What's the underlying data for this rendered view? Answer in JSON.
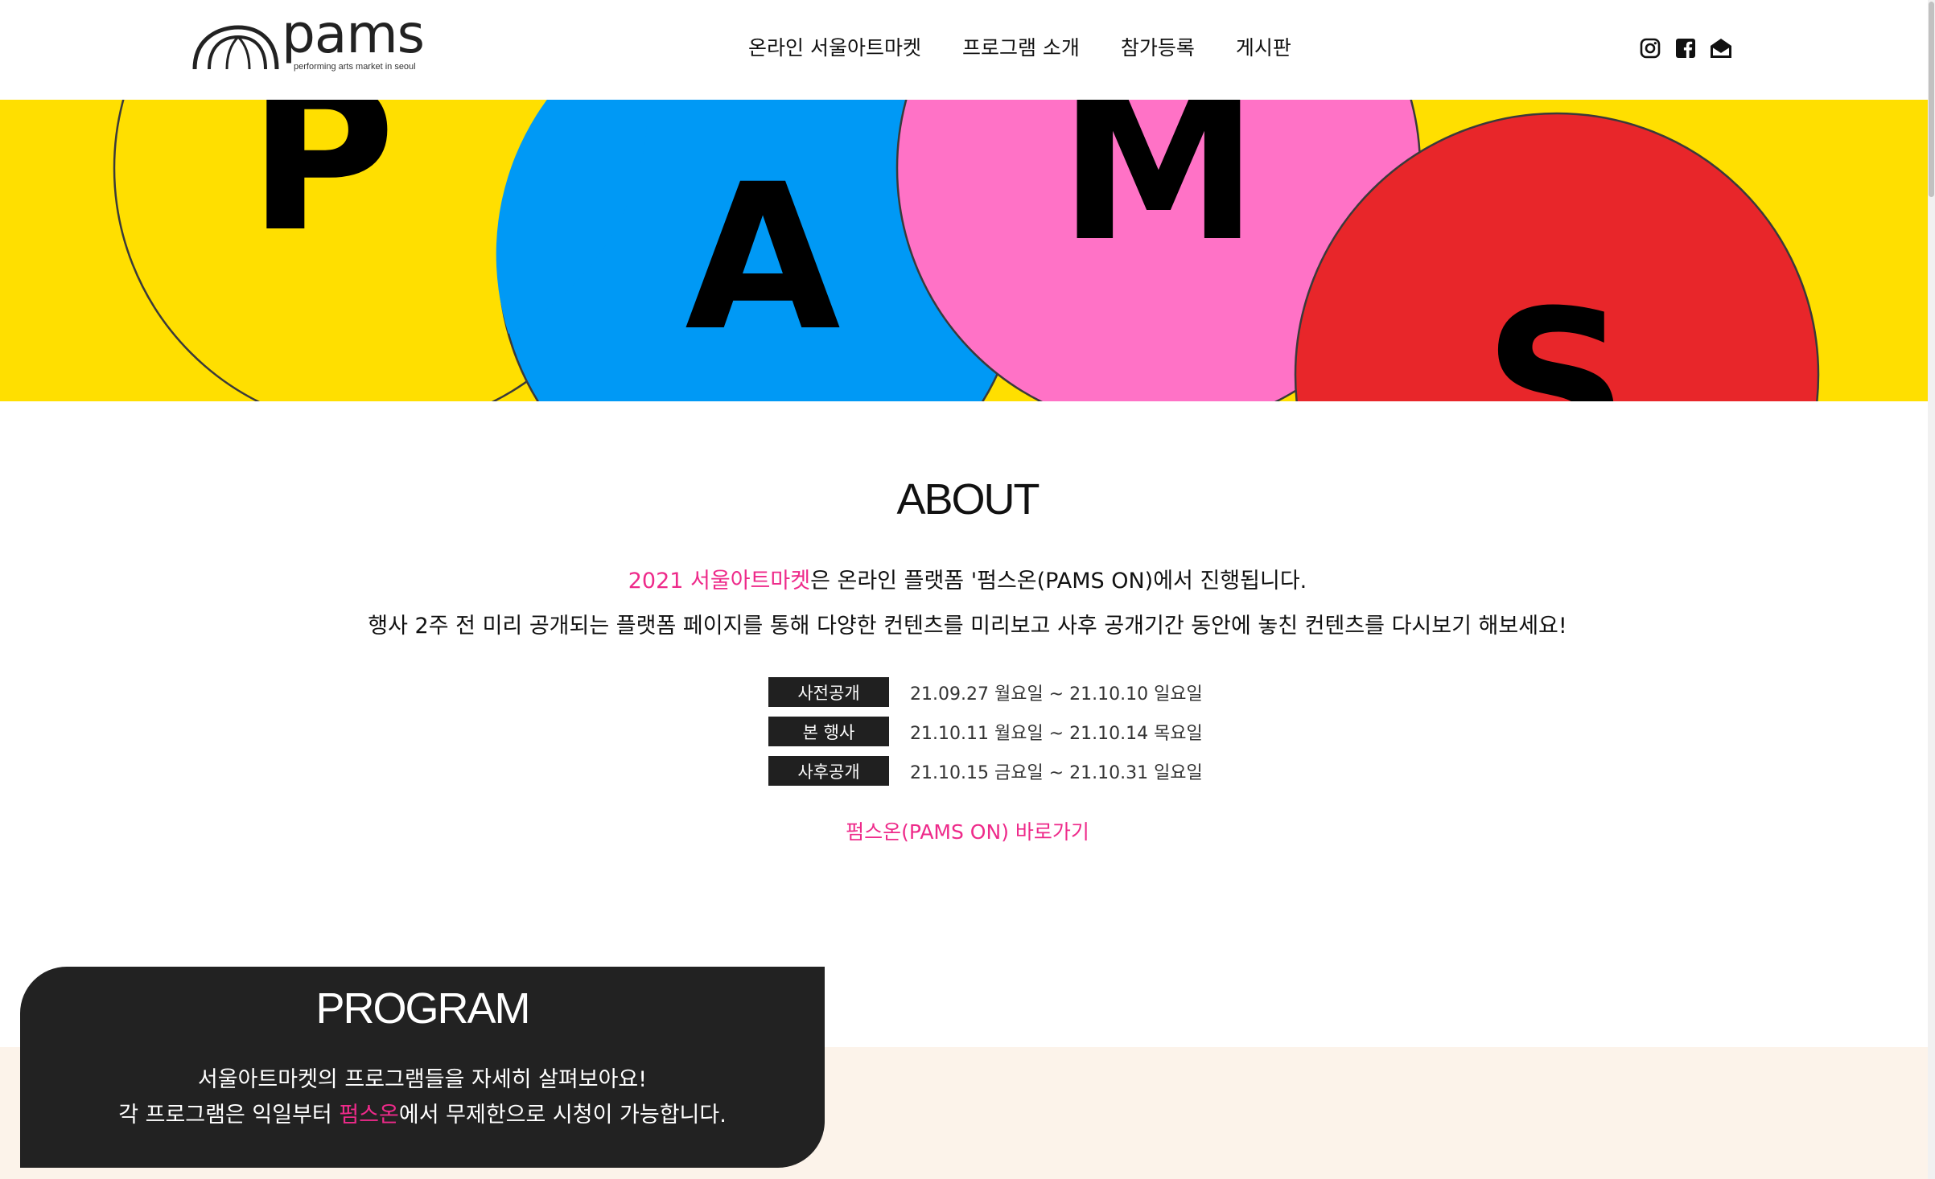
{
  "header": {
    "logo": {
      "word": "pams",
      "tagline": "performing arts market in seoul"
    },
    "nav": [
      {
        "label": "온라인 서울아트마켓"
      },
      {
        "label": "프로그램 소개"
      },
      {
        "label": "참가등록"
      },
      {
        "label": "게시판"
      }
    ],
    "social": [
      {
        "icon": "instagram-icon"
      },
      {
        "icon": "facebook-icon"
      },
      {
        "icon": "mail-icon"
      }
    ]
  },
  "hero": {
    "letters": [
      "P",
      "A",
      "M",
      "S"
    ],
    "colors": {
      "yellow": "#ffdf00",
      "blue": "#0099f5",
      "pink": "#ff72c6",
      "red": "#e8262a"
    }
  },
  "about": {
    "title": "ABOUT",
    "line1_highlight": "2021 서울아트마켓",
    "line1_rest": "은 온라인 플랫폼 '펌스온(PAMS ON)에서 진행됩니다.",
    "line2": "행사 2주 전 미리 공개되는 플랫폼 페이지를 통해 다양한 컨텐츠를 미리보고 사후 공개기간 동안에 놓친 컨텐츠를 다시보기 해보세요!",
    "schedule": [
      {
        "label": "사전공개",
        "dates": "21.09.27 월요일 ~ 21.10.10 일요일"
      },
      {
        "label": "본 행사",
        "dates": "21.10.11 월요일 ~ 21.10.14 목요일"
      },
      {
        "label": "사후공개",
        "dates": "21.10.15 금요일 ~ 21.10.31 일요일"
      }
    ],
    "link": "펌스온(PAMS ON) 바로가기"
  },
  "program": {
    "title": "PROGRAM",
    "line1": "서울아트마켓의 프로그램들을 자세히 살펴보아요!",
    "line2_pre": "각 프로그램은 익일부터 ",
    "line2_highlight": "펌스온",
    "line2_post": "에서 무제한으로 시청이 가능합니다."
  },
  "colors": {
    "accent": "#ee2a8a",
    "dark": "#222222",
    "beige": "#fcf3ea"
  }
}
